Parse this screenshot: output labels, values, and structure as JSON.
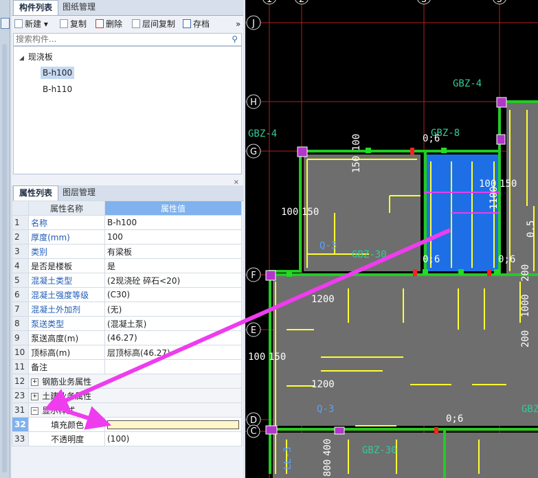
{
  "tabs_top": {
    "components": "构件列表",
    "drawings": "图纸管理"
  },
  "toolbar": {
    "new": "新建",
    "copy": "复制",
    "delete": "删除",
    "floor_copy": "层间复制",
    "save": "存档",
    "more": "»"
  },
  "search": {
    "placeholder": "搜索构件..."
  },
  "tree": {
    "root": "现浇板",
    "items": [
      "B-h100",
      "B-h110"
    ]
  },
  "tabs_bottom": {
    "properties": "属性列表",
    "layers": "图层管理"
  },
  "close_symbol": "×",
  "props": {
    "head_name": "属性名称",
    "head_value": "属性值",
    "rows": [
      {
        "no": "1",
        "name": "名称",
        "value": "B-h100"
      },
      {
        "no": "2",
        "name": "厚度(mm)",
        "value": "100"
      },
      {
        "no": "3",
        "name": "类别",
        "value": "有梁板"
      },
      {
        "no": "4",
        "name": "是否是楼板",
        "value": "是"
      },
      {
        "no": "5",
        "name": "混凝土类型",
        "value": "(2现浇砼 碎石<20)"
      },
      {
        "no": "6",
        "name": "混凝土强度等级",
        "value": "(C30)"
      },
      {
        "no": "7",
        "name": "混凝土外加剂",
        "value": "(无)"
      },
      {
        "no": "8",
        "name": "泵送类型",
        "value": "(混凝土泵)"
      },
      {
        "no": "9",
        "name": "泵送高度(m)",
        "value": "(46.27)"
      },
      {
        "no": "10",
        "name": "顶标高(m)",
        "value": "层顶标高(46.27)"
      },
      {
        "no": "11",
        "name": "备注",
        "value": ""
      },
      {
        "no": "12",
        "name": "钢筋业务属性"
      },
      {
        "no": "23",
        "name": "土建业务属性"
      },
      {
        "no": "31",
        "name": "显示样式"
      },
      {
        "no": "32",
        "name": "填充颜色"
      },
      {
        "no": "33",
        "name": "不透明度",
        "value": "(100)"
      }
    ]
  },
  "expanders": {
    "plus": "+",
    "minus": "−"
  },
  "cad": {
    "axis_top": [
      "1",
      "2",
      "3",
      "5"
    ],
    "axis_left": [
      "J",
      "H",
      "G",
      "F",
      "E",
      "D",
      "C"
    ],
    "labels": [
      "GBZ-4",
      "GBZ-4",
      "GBZ-8",
      "0;6",
      "150",
      "100",
      "100",
      "150",
      "1100",
      "100",
      "150",
      "Q-3",
      "GBZ-30",
      "0;6",
      "0;6",
      "1200",
      "100",
      "150",
      "1200",
      "Q-3",
      "0;6",
      "GBZ-30",
      "LL-3",
      "400",
      "800",
      "200",
      "1000",
      "200",
      "0.5",
      "GBZ"
    ]
  },
  "colors": {
    "accent": "#7fb2ee",
    "arrow": "#ee3cee",
    "green": "#22cc22",
    "yellow": "#ffff33",
    "blue_fill": "#1e6fe6",
    "axis_red": "#cc2222"
  }
}
